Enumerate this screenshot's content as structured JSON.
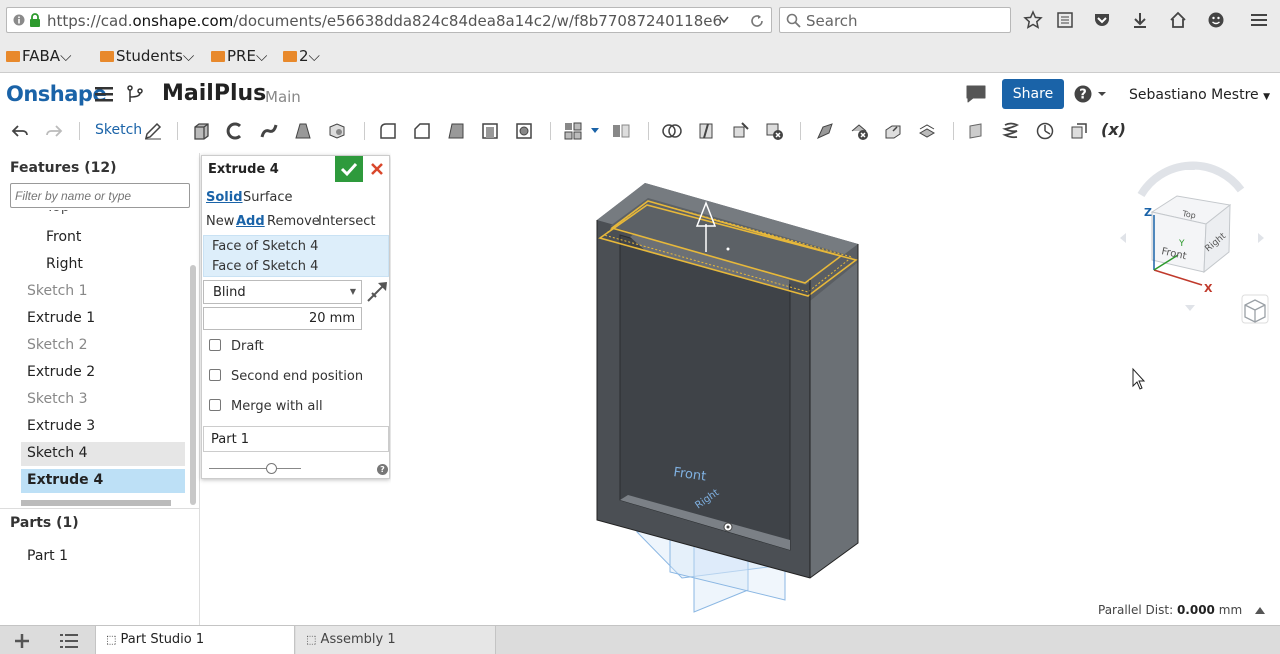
{
  "browser": {
    "url_prefix": "https://cad.",
    "url_host": "onshape.com",
    "url_path": "/documents/e56638dda824c84dea8a14c2/w/f8b77087240118e6",
    "search_placeholder": "Search"
  },
  "bookmarks": [
    {
      "label": "FABA"
    },
    {
      "label": "Students"
    },
    {
      "label": "PRE"
    },
    {
      "label": "2"
    }
  ],
  "app": {
    "logo": "Onshape",
    "document_name": "MailPlus",
    "branch": "Main",
    "share_label": "Share",
    "user_name": "Sebastiano Mestre"
  },
  "toolbar": {
    "sketch_label": "Sketch"
  },
  "features": {
    "title": "Features (12)",
    "filter_placeholder": "Filter by name or type",
    "items": [
      {
        "label": "Top",
        "state": "dim"
      },
      {
        "label": "Front",
        "state": "plane"
      },
      {
        "label": "Right",
        "state": "plane"
      },
      {
        "label": "Sketch 1",
        "state": "dim"
      },
      {
        "label": "Extrude 1",
        "state": "normal"
      },
      {
        "label": "Sketch 2",
        "state": "dim"
      },
      {
        "label": "Extrude 2",
        "state": "normal"
      },
      {
        "label": "Sketch 3",
        "state": "dim"
      },
      {
        "label": "Extrude 3",
        "state": "normal"
      },
      {
        "label": "Sketch 4",
        "state": "highlight"
      },
      {
        "label": "Extrude 4",
        "state": "selected"
      }
    ]
  },
  "parts": {
    "title": "Parts (1)",
    "items": [
      {
        "label": "Part 1"
      }
    ]
  },
  "dialog": {
    "title": "Extrude 4",
    "body_solid": "Solid",
    "body_surface": "Surface",
    "op_new": "New",
    "op_add": "Add",
    "op_remove": "Remove",
    "op_intersect": "Intersect",
    "faces": [
      "Face of Sketch 4",
      "Face of Sketch 4"
    ],
    "end_type": "Blind",
    "depth": "20 mm",
    "draft_label": "Draft",
    "second_end_label": "Second end position",
    "merge_label": "Merge with all",
    "merge_scope": "Part 1"
  },
  "viewcube": {
    "axis_z": "Z",
    "axis_x": "X",
    "axis_y": "Y",
    "face_top": "Top",
    "face_front": "Front",
    "face_right": "Right"
  },
  "viewport": {
    "plane_front": "Front",
    "plane_right": "Right",
    "parallel_dist_label": "Parallel Dist:",
    "parallel_dist_value": "0.000",
    "parallel_dist_unit": "mm"
  },
  "tabs": [
    {
      "label": "Part Studio 1",
      "active": true
    },
    {
      "label": "Assembly 1",
      "active": false
    }
  ]
}
